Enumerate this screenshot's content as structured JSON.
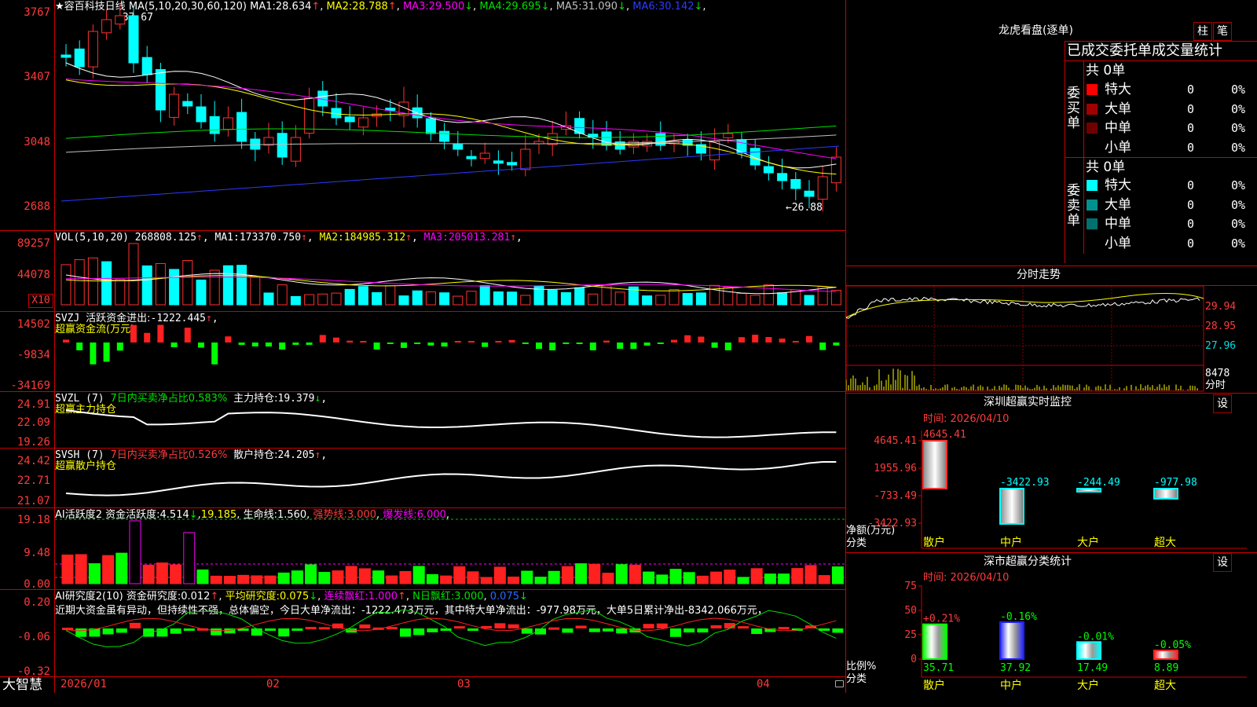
{
  "chart_header": {
    "stock_name": "★容百科技",
    "period": "日线",
    "ma_params": "MA(5,10,20,30,60,120)",
    "ma": [
      {
        "label": "MA1:",
        "value": "28.634",
        "arrow": "↑",
        "color": "#ffffff"
      },
      {
        "label": "MA2:",
        "value": "28.788",
        "arrow": "↑",
        "color": "#ffff00"
      },
      {
        "label": "MA3:",
        "value": "29.500",
        "arrow": "↓",
        "color": "#ff00ff"
      },
      {
        "label": "MA4:",
        "value": "29.695",
        "arrow": "↓",
        "color": "#00e000"
      },
      {
        "label": "MA5:",
        "value": "31.090",
        "arrow": "↓",
        "color": "#c0c0c0"
      },
      {
        "label": "MA6:",
        "value": "30.142",
        "arrow": "↓",
        "color": "#2b3bff"
      }
    ],
    "high_mark": "37.67",
    "low_mark": "26.88"
  },
  "price_axis": [
    "3767",
    "3407",
    "3048",
    "2688"
  ],
  "vol": {
    "params": "VOL(5,10,20)",
    "value": "268808.125",
    "ma": [
      {
        "label": "MA1:",
        "value": "173370.750",
        "arrow": "↑",
        "color": "#ffffff"
      },
      {
        "label": "MA2:",
        "value": "184985.312",
        "arrow": "↑",
        "color": "#ffff00"
      },
      {
        "label": "MA3:",
        "value": "205013.281",
        "arrow": "↑",
        "color": "#ff00ff"
      }
    ],
    "axis": [
      "89257",
      "44078"
    ],
    "unit": "X10"
  },
  "svzj": {
    "title": "SVZJ",
    "label": "活跃资金进出:",
    "value": "-1222.445",
    "arrow": "↑",
    "subtitle": "超赢资金流(万元)",
    "axis": [
      "14502",
      "-9834",
      "-34169"
    ]
  },
  "svzl": {
    "title": "SVZL (7)",
    "ratio_label": "7日内买卖净占比0.583%",
    "label": "主力持仓:",
    "value": "19.379",
    "arrow": "↓",
    "subtitle": "超赢主力持仓",
    "axis": [
      "24.91",
      "22.09",
      "19.26"
    ]
  },
  "svsh": {
    "title": "SVSH (7)",
    "ratio_label": "7日内买卖净占比0.526%",
    "label": "散户持仓:",
    "value": "24.205",
    "arrow": "↑",
    "subtitle": "超赢散户持仓",
    "axis": [
      "24.42",
      "22.71",
      "21.07"
    ]
  },
  "ai_active": {
    "title": "AI活跃度2",
    "label1": "资金活跃度:",
    "value1": "4.514",
    "arrow1": "↓",
    "value1b": "19.185",
    "label2": "生命线:",
    "value2": "1.560",
    "label3": "强势线:",
    "value3": "3.000",
    "label4": "爆发线:",
    "value4": "6.000",
    "axis": [
      "19.18",
      "9.48",
      "0.00"
    ]
  },
  "ai_research": {
    "title": "AI研究度2(10)",
    "label1": "资金研究度:",
    "value1": "0.012",
    "arrow1": "↑",
    "label2": "平均研究度:",
    "value2": "0.075",
    "arrow2": "↓",
    "label3": "连续飘红:",
    "value3": "1.000",
    "arrow3": "↑",
    "label4": "N日飘红:",
    "value4": "3.000",
    "value5": "0.075",
    "arrow5": "↓",
    "comment": "近期大资金虽有异动，但持续性不强，总体偏空，今日大单净流出：-1222.473万元，其中特大单净流出：-977.98万元，大单5日累计净出-8342.066万元，",
    "axis": [
      "0.20",
      "-0.06",
      "-0.32"
    ]
  },
  "date_axis": [
    "2026/01",
    "02",
    "03",
    "04"
  ],
  "brand": "大智慧",
  "longhu": {
    "title": "龙虎看盘(逐单)",
    "btn_zhu": "柱",
    "btn_bi": "笔",
    "heading": "已成交委托单成交量统计",
    "buy_side": "委买单",
    "sell_side": "委卖单",
    "buy_total": "共 0单",
    "sell_total": "共 0单",
    "buy_rows": [
      {
        "label": "特大",
        "count": "0",
        "pct": "0%",
        "color": "#ff0000"
      },
      {
        "label": "大单",
        "count": "0",
        "pct": "0%",
        "color": "#a00000"
      },
      {
        "label": "中单",
        "count": "0",
        "pct": "0%",
        "color": "#700000"
      },
      {
        "label": "小单",
        "count": "0",
        "pct": "0%",
        "color": ""
      }
    ],
    "sell_rows": [
      {
        "label": "特大",
        "count": "0",
        "pct": "0%",
        "color": "#00ffff"
      },
      {
        "label": "大单",
        "count": "0",
        "pct": "0%",
        "color": "#009090"
      },
      {
        "label": "中单",
        "count": "0",
        "pct": "0%",
        "color": "#007070"
      },
      {
        "label": "小单",
        "count": "0",
        "pct": "0%",
        "color": ""
      }
    ]
  },
  "intraday": {
    "title": "分时走势",
    "axis": [
      "29.94",
      "28.95",
      "27.96"
    ],
    "vol_axis": "8478",
    "vol_unit": "分时"
  },
  "sz_monitor": {
    "title": "深圳超赢实时监控",
    "btn": "设",
    "time": "时间: 2026/04/10",
    "axis": [
      "4645.41",
      "1955.96",
      "-733.49",
      "-3422.93"
    ],
    "ylabel": "净额(万元)",
    "xlabel": "分类",
    "chart_data": {
      "type": "bar",
      "categories": [
        "散户",
        "中户",
        "大户",
        "超大"
      ],
      "values": [
        4645.41,
        -3422.93,
        -244.49,
        -977.98
      ],
      "value_labels": [
        "4645.41",
        "-3422.93",
        "-244.49",
        "-977.98"
      ],
      "ylim": [
        -3422.93,
        4645.41
      ]
    }
  },
  "sz_class": {
    "title": "深市超赢分类统计",
    "btn": "设",
    "time": "时间: 2026/04/10",
    "axis": [
      "75",
      "50",
      "25",
      "0"
    ],
    "ylabel": "比例%",
    "xlabel": "分类",
    "chart_data": {
      "type": "bar",
      "categories": [
        "散户",
        "中户",
        "大户",
        "超大"
      ],
      "values": [
        35.71,
        37.92,
        17.49,
        8.89
      ],
      "change_labels": [
        "+0.21%",
        "-0.16%",
        "-0.01%",
        "-0.05%"
      ],
      "value_labels": [
        "35.71",
        "37.92",
        "17.49",
        "8.89"
      ],
      "ylim": [
        0,
        75
      ]
    }
  }
}
